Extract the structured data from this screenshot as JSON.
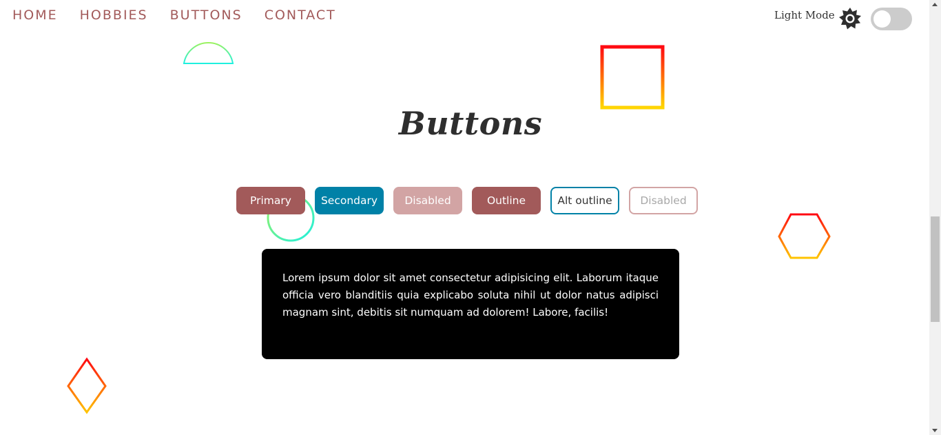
{
  "nav": {
    "items": [
      {
        "label": "HOME"
      },
      {
        "label": "HOBBIES"
      },
      {
        "label": "BUTTONS"
      },
      {
        "label": "CONTACT"
      }
    ]
  },
  "mode": {
    "label": "Light Mode",
    "icon": "gear-icon",
    "toggle_on": false
  },
  "page_title": "Buttons",
  "buttons": {
    "primary": "Primary",
    "secondary": "Secondary",
    "disabled": "Disabled",
    "outline": "Outline",
    "alt_outline": "Alt outline",
    "disabled_outline": "Disabled"
  },
  "card": {
    "text": "Lorem ipsum dolor sit amet consectetur adipisicing elit. Laborum itaque officia vero blanditiis quia explicabo soluta nihil ut dolor natus adipisci magnam sint, debitis sit numquam ad dolorem! Labore, facilis!"
  },
  "colors": {
    "brand": "#a25a5a",
    "secondary": "#0081a7",
    "disabled": "#d2a4a4",
    "card_bg": "#000000"
  }
}
